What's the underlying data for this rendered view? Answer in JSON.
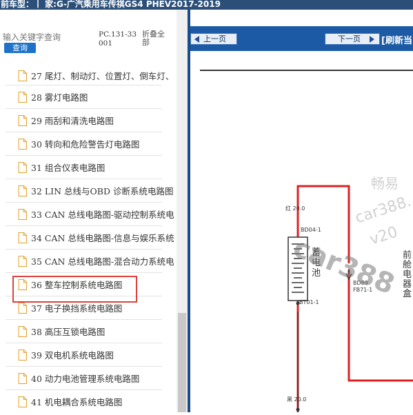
{
  "window": {
    "title": "前车型：丨 家:G-广汽乘用车传祺GS4 PHEV2017-2019"
  },
  "search": {
    "placeholder": "输入关键字查询",
    "button_label": "查询",
    "code": "PC.131-33001",
    "collapse_label": "折叠全部"
  },
  "tree": {
    "items": [
      {
        "label": "27 尾灯、制动灯、位置灯、倒车灯、"
      },
      {
        "label": "28 雾灯电路图"
      },
      {
        "label": "29 雨刮和清洗电路图"
      },
      {
        "label": "30 转向和危险警告灯电路图"
      },
      {
        "label": "31 组合仪表电路图"
      },
      {
        "label": "32 LIN 总线与OBD 诊断系统电路图"
      },
      {
        "label": "33 CAN 总线电路图-驱动控制系统电"
      },
      {
        "label": "34 CAN 总线电路图-信息与娱乐系统"
      },
      {
        "label": "35 CAN 总线电路图-混合动力系统电"
      },
      {
        "label": "36 整车控制系统电路图"
      },
      {
        "label": "37 电子换挡系统电路图"
      },
      {
        "label": "38 高压互锁电路图"
      },
      {
        "label": "39 双电机系统电路图"
      },
      {
        "label": "40 动力电池管理系统电路图"
      },
      {
        "label": "41 机电耦合系统电路图"
      }
    ],
    "selected_index": 9
  },
  "viewer": {
    "prev_label": "上一页",
    "next_label": "下一页",
    "refresh_label": "[刷新当"
  },
  "diagram": {
    "wire_red_label": "红 20.0",
    "connector_top": "BD04-1",
    "battery_label": "蓄电池",
    "connector_bottom": "BT01-1",
    "wire_black_label": "黑 20.0",
    "connector_bd89": "BD89",
    "connector_fb71": "FB71-1",
    "fuse_box_label": "前舱电器盒",
    "wire_color": "#e02020"
  },
  "watermark": {
    "brand": "car388",
    "cn": "畅易",
    "url_part": "car388.",
    "year_part": "v20"
  },
  "colors": {
    "toolbar_blue": "#1c5aa6",
    "title_bar": "#2b4f79",
    "highlight_red": "#e0403a",
    "search_button": "#1e73c8"
  }
}
